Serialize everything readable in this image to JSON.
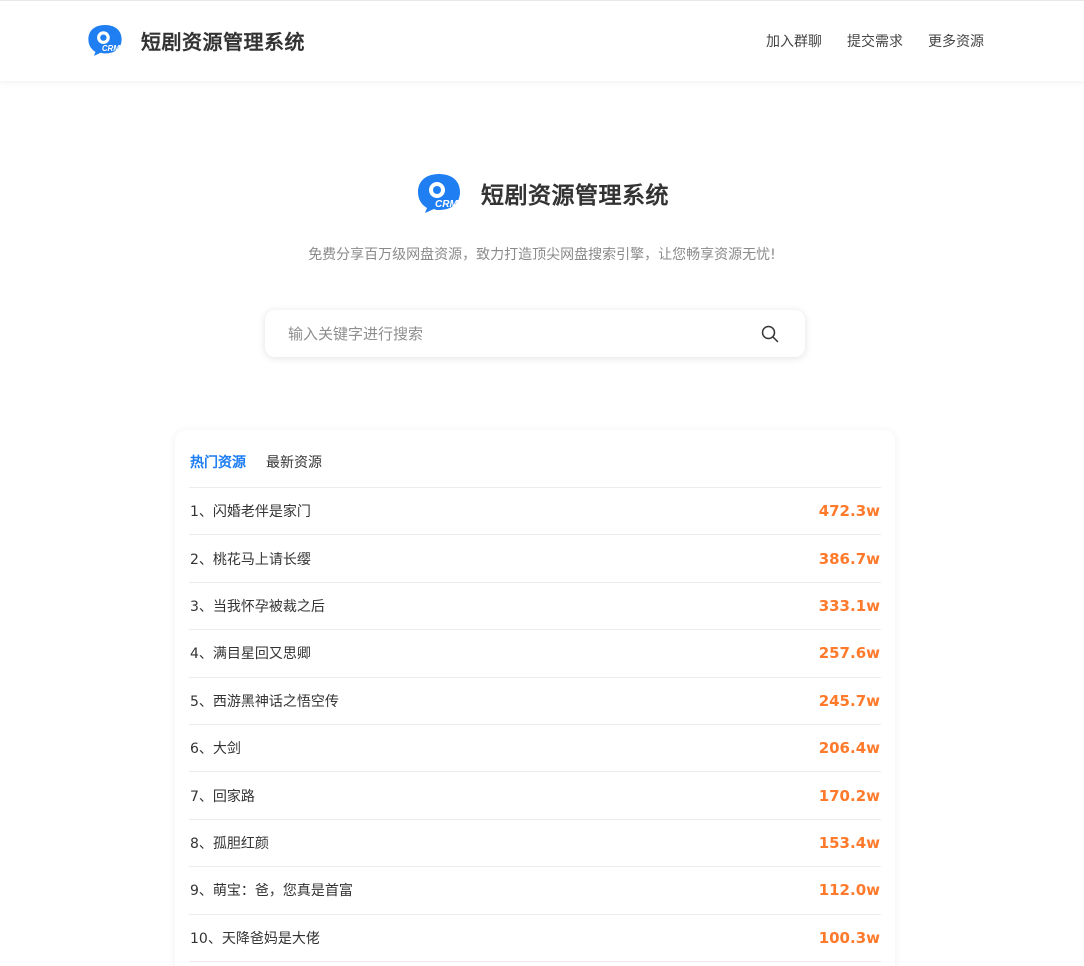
{
  "header": {
    "brand_name": "短剧资源管理系统",
    "logo_text": "CRM",
    "nav": [
      "加入群聊",
      "提交需求",
      "更多资源"
    ]
  },
  "hero": {
    "title": "短剧资源管理系统",
    "logo_text": "CRM",
    "subtitle": "免费分享百万级网盘资源，致力打造顶尖网盘搜索引擎，让您畅享资源无忧!"
  },
  "search": {
    "placeholder": "输入关键字进行搜索",
    "value": ""
  },
  "tabs": [
    {
      "label": "热门资源",
      "active": true
    },
    {
      "label": "最新资源",
      "active": false
    }
  ],
  "list": [
    {
      "title": "1、闪婚老伴是家门",
      "views": "472.3w"
    },
    {
      "title": "2、桃花马上请长缨",
      "views": "386.7w"
    },
    {
      "title": "3、当我怀孕被裁之后",
      "views": "333.1w"
    },
    {
      "title": "4、满目星回又思卿",
      "views": "257.6w"
    },
    {
      "title": "5、西游黑神话之悟空传",
      "views": "245.7w"
    },
    {
      "title": "6、大剑",
      "views": "206.4w"
    },
    {
      "title": "7、回家路",
      "views": "170.2w"
    },
    {
      "title": "8、孤胆红颜",
      "views": "153.4w"
    },
    {
      "title": "9、萌宝：爸，您真是首富",
      "views": "112.0w"
    },
    {
      "title": "10、天降爸妈是大佬",
      "views": "100.3w"
    }
  ],
  "colors": {
    "accent": "#1e7ef2",
    "hot_count": "#ff7a2b"
  }
}
